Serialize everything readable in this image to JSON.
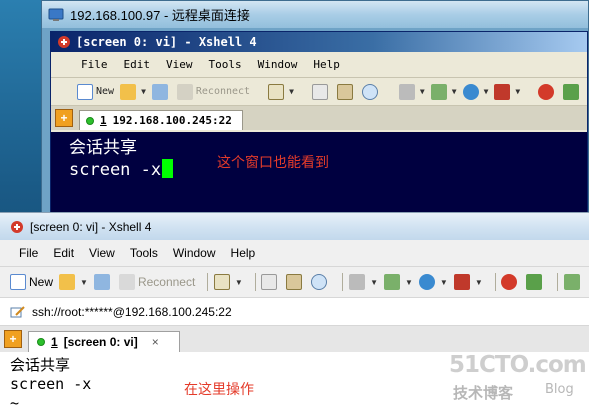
{
  "rdp": {
    "title": "192.168.100.97 - 远程桌面连接"
  },
  "back_xshell": {
    "title": "[screen 0: vi]  - Xshell 4",
    "menu": [
      "File",
      "Edit",
      "View",
      "Tools",
      "Window",
      "Help"
    ],
    "toolbar": {
      "new": "New",
      "reconnect": "Reconnect"
    },
    "tab": {
      "number": "1",
      "label": "192.168.100.245:22"
    },
    "terminal_lines": [
      "会话共享",
      "screen -x"
    ],
    "annotation": "这个窗口也能看到"
  },
  "front_xshell": {
    "title": "[screen 0: vi] - Xshell 4",
    "menu": [
      "File",
      "Edit",
      "View",
      "Tools",
      "Window",
      "Help"
    ],
    "toolbar": {
      "new": "New",
      "reconnect": "Reconnect"
    },
    "address": "ssh://root:******@192.168.100.245:22",
    "tab": {
      "number": "1",
      "label": "[screen 0: vi]",
      "close": "×"
    },
    "terminal_lines": [
      "会话共享",
      "screen -x",
      "~"
    ],
    "annotation": "在这里操作"
  },
  "watermark": {
    "big": "51CTO.com",
    "small": "技术博客",
    "blog": "Blog"
  },
  "colors": {
    "terminal_bg_back": "#000040",
    "cursor": "#00ff00",
    "annotation": "#e43b2a",
    "tab_dot": "#2cbf2c"
  }
}
